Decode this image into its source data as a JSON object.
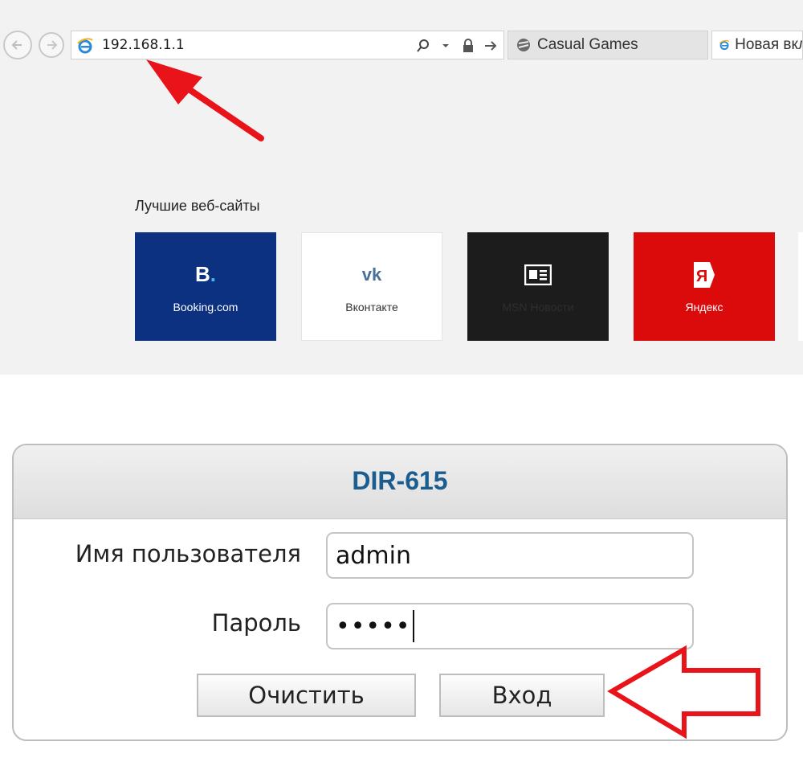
{
  "browser": {
    "address_bar": {
      "url": "192.168.1.1"
    },
    "tabs": [
      {
        "label": "Casual Games"
      },
      {
        "label": "Новая вкладка"
      }
    ],
    "top_sites": {
      "title": "Лучшие веб-сайты",
      "tiles": [
        {
          "label": "Booking.com",
          "color": "#0b3180"
        },
        {
          "label": "Вконтакте",
          "color": "#ffffff"
        },
        {
          "label": "MSN Новости",
          "color": "#1c1c1c"
        },
        {
          "label": "Яндекс",
          "color": "#dc0b0b"
        }
      ]
    }
  },
  "login": {
    "title": "DIR-615",
    "username_label": "Имя пользователя",
    "username_value": "admin",
    "password_label": "Пароль",
    "password_mask": "•••••",
    "clear_label": "Очистить",
    "login_label": "Вход",
    "accent_color": "#1b5d8f"
  },
  "annotations": {
    "arrow_color": "#e8141a"
  }
}
